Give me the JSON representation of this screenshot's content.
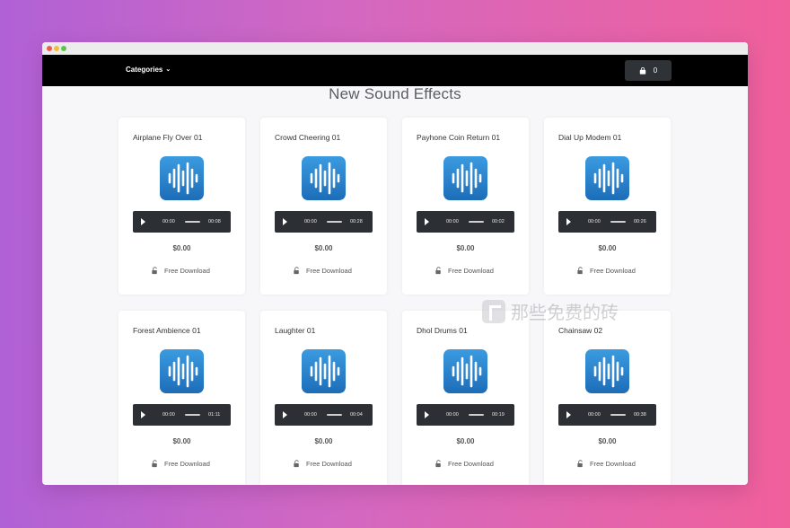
{
  "nav": {
    "categories_label": "Categories",
    "cart_count": "0"
  },
  "page": {
    "title": "New Sound Effects"
  },
  "cards": [
    {
      "title": "Airplane Fly Over 01",
      "current": "00:00",
      "duration": "00:08",
      "price": "$0.00",
      "download": "Free Download"
    },
    {
      "title": "Crowd Cheering 01",
      "current": "00:00",
      "duration": "00:28",
      "price": "$0.00",
      "download": "Free Download"
    },
    {
      "title": "Payhone Coin Return 01",
      "current": "00:00",
      "duration": "00:02",
      "price": "$0.00",
      "download": "Free Download"
    },
    {
      "title": "Dial Up Modem 01",
      "current": "00:00",
      "duration": "00:26",
      "price": "$0.00",
      "download": "Free Download"
    },
    {
      "title": "Forest Ambience 01",
      "current": "00:00",
      "duration": "01:11",
      "price": "$0.00",
      "download": "Free Download"
    },
    {
      "title": "Laughter 01",
      "current": "00:00",
      "duration": "00:04",
      "price": "$0.00",
      "download": "Free Download"
    },
    {
      "title": "Dhol Drums 01",
      "current": "00:00",
      "duration": "00:19",
      "price": "$0.00",
      "download": "Free Download"
    },
    {
      "title": "Chainsaw 02",
      "current": "00:00",
      "duration": "00:38",
      "price": "$0.00",
      "download": "Free Download"
    }
  ],
  "watermark": {
    "text": "那些免费的砖"
  },
  "colors": {
    "accent_blue": "#2a86d4",
    "navbar": "#000000",
    "player": "#2c2f34"
  },
  "icons": [
    "chevron-down-icon",
    "shopping-bag-icon",
    "sound-wave-icon",
    "play-icon",
    "unlock-icon"
  ]
}
